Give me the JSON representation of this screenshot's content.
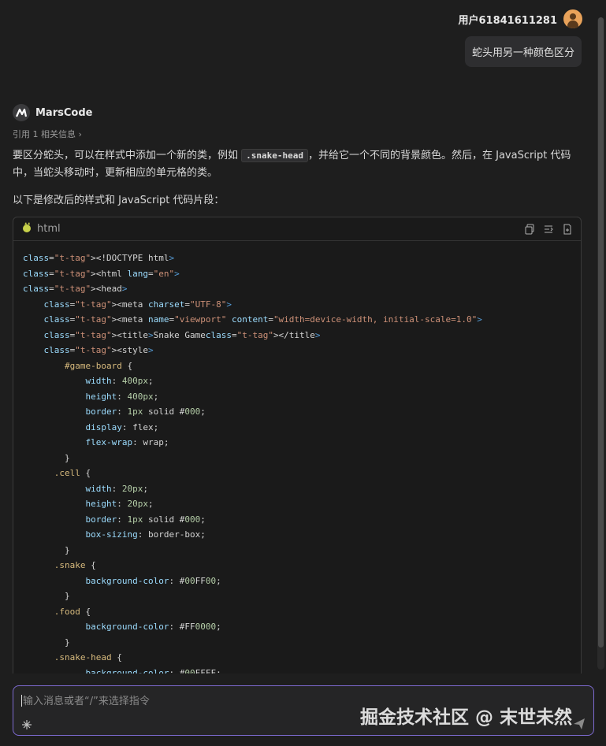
{
  "user": {
    "name": "用户61841611281",
    "message": "蛇头用另一种颜色区分"
  },
  "bot": {
    "name": "MarsCode",
    "reference": "引用 1 相关信息 ›"
  },
  "answer": {
    "p1_before": "要区分蛇头，可以在样式中添加一个新的类，例如 ",
    "p1_code": ".snake-head",
    "p1_after": "，并给它一个不同的背景颜色。然后，在 JavaScript 代码中，当蛇头移动时，更新相应的单元格的类。",
    "p2": "以下是修改后的样式和 JavaScript 代码片段："
  },
  "code_block": {
    "language": "html",
    "lines": [
      "<!DOCTYPE html>",
      "<html lang=\"en\">",
      "<head>",
      "    <meta charset=\"UTF-8\">",
      "    <meta name=\"viewport\" content=\"width=device-width, initial-scale=1.0\">",
      "    <title>Snake Game</title>",
      "    <style>",
      "        #game-board {",
      "            width: 400px;",
      "            height: 400px;",
      "            border: 1px solid #000;",
      "            display: flex;",
      "            flex-wrap: wrap;",
      "        }",
      "      .cell {",
      "            width: 20px;",
      "            height: 20px;",
      "            border: 1px solid #000;",
      "            box-sizing: border-box;",
      "        }",
      "      .snake {",
      "            background-color: #00FF00;",
      "        }",
      "      .food {",
      "            background-color: #FF0000;",
      "        }",
      "      .snake-head {",
      "            background-color: #00FFFF;"
    ]
  },
  "composer": {
    "placeholder": "输入消息或者“/”来选择指令"
  },
  "watermark": "掘金技术社区 @ 末世未然",
  "icons": {
    "avatar": "user-avatar-icon",
    "bot_logo": "marscode-logo-icon",
    "lang": "html-language-icon",
    "copy": "copy-icon",
    "insert": "insert-icon",
    "new_file": "new-file-icon",
    "sparkle": "sparkle-icon",
    "send": "send-icon"
  },
  "colors": {
    "background": "#1e1e1e",
    "input_border": "#7d6ad0",
    "avatar": "#e8a25a",
    "accent_lang_icon": "#c7d14a"
  }
}
